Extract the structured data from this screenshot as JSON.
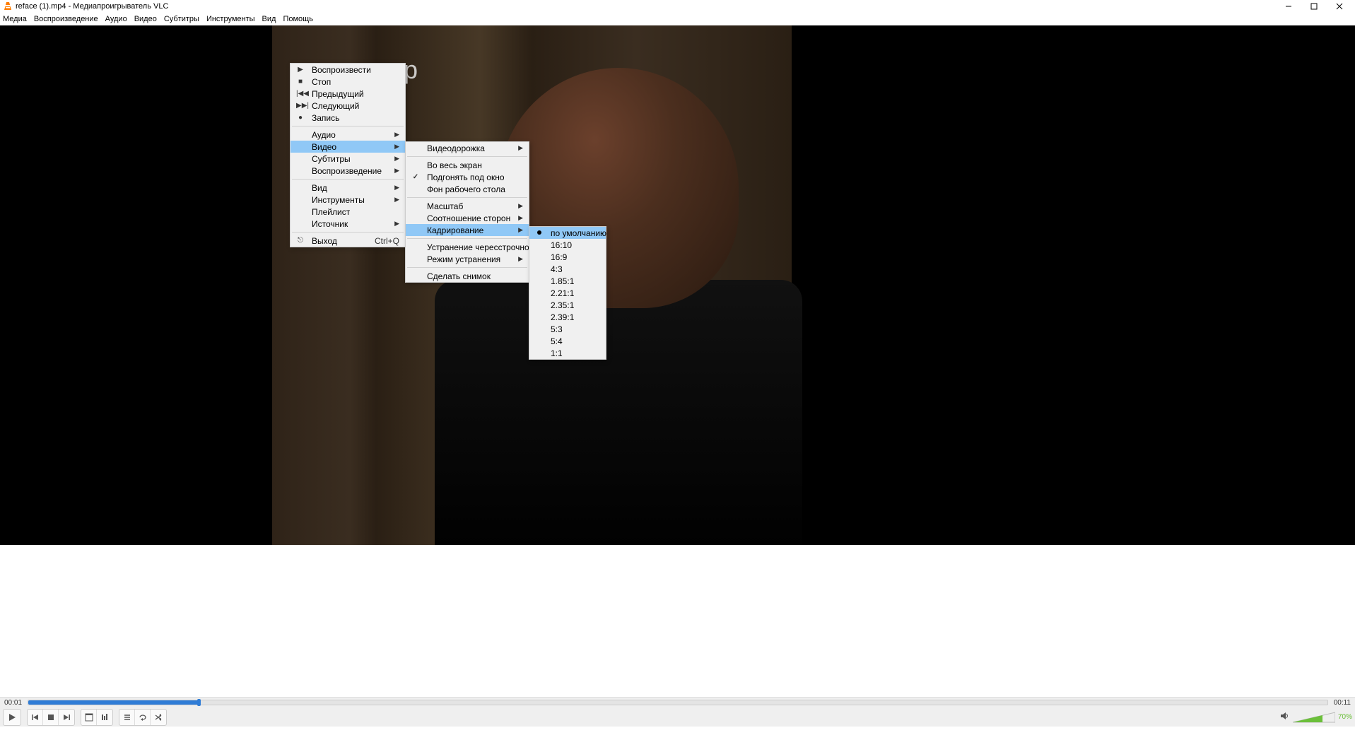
{
  "window": {
    "title": "reface (1).mp4 - Медиапроигрыватель VLC"
  },
  "menubar": [
    "Медиа",
    "Воспроизведение",
    "Аудио",
    "Видео",
    "Субтитры",
    "Инструменты",
    "Вид",
    "Помощь"
  ],
  "watermark": "pp",
  "context1": {
    "items": [
      {
        "label": "Воспроизвести",
        "icon": "play"
      },
      {
        "label": "Стоп",
        "icon": "stop"
      },
      {
        "label": "Предыдущий",
        "icon": "prev"
      },
      {
        "label": "Следующий",
        "icon": "next"
      },
      {
        "label": "Запись",
        "icon": "record"
      }
    ],
    "items2": [
      {
        "label": "Аудио",
        "arrow": true
      },
      {
        "label": "Видео",
        "arrow": true,
        "highlight": true
      },
      {
        "label": "Субтитры",
        "arrow": true
      },
      {
        "label": "Воспроизведение",
        "arrow": true
      }
    ],
    "items3": [
      {
        "label": "Вид",
        "arrow": true
      },
      {
        "label": "Инструменты",
        "arrow": true
      },
      {
        "label": "Плейлист"
      },
      {
        "label": "Источник",
        "arrow": true
      }
    ],
    "items4": [
      {
        "label": "Выход",
        "icon": "exit",
        "shortcut": "Ctrl+Q"
      }
    ]
  },
  "context2": {
    "items": [
      {
        "label": "Видеодорожка",
        "arrow": true
      },
      {
        "label": "Во весь экран"
      },
      {
        "label": "Подгонять под окно",
        "checked": true
      },
      {
        "label": "Фон рабочего стола"
      }
    ],
    "items2": [
      {
        "label": "Масштаб",
        "arrow": true
      },
      {
        "label": "Соотношение сторон",
        "arrow": true
      },
      {
        "label": "Кадрирование",
        "arrow": true,
        "highlight": true
      }
    ],
    "items3": [
      {
        "label": "Устранение чересстрочности",
        "arrow": true
      },
      {
        "label": "Режим устранения",
        "arrow": true
      }
    ],
    "items4": [
      {
        "label": "Сделать снимок"
      }
    ]
  },
  "context3": {
    "items": [
      {
        "label": "по умолчанию",
        "radio": true,
        "highlight": true
      },
      {
        "label": "16:10"
      },
      {
        "label": "16:9"
      },
      {
        "label": "4:3"
      },
      {
        "label": "1.85:1"
      },
      {
        "label": "2.21:1"
      },
      {
        "label": "2.35:1"
      },
      {
        "label": "2.39:1"
      },
      {
        "label": "5:3"
      },
      {
        "label": "5:4"
      },
      {
        "label": "1:1"
      }
    ]
  },
  "seek": {
    "current": "00:01",
    "total": "00:11"
  },
  "volume": {
    "percent": "70%"
  }
}
